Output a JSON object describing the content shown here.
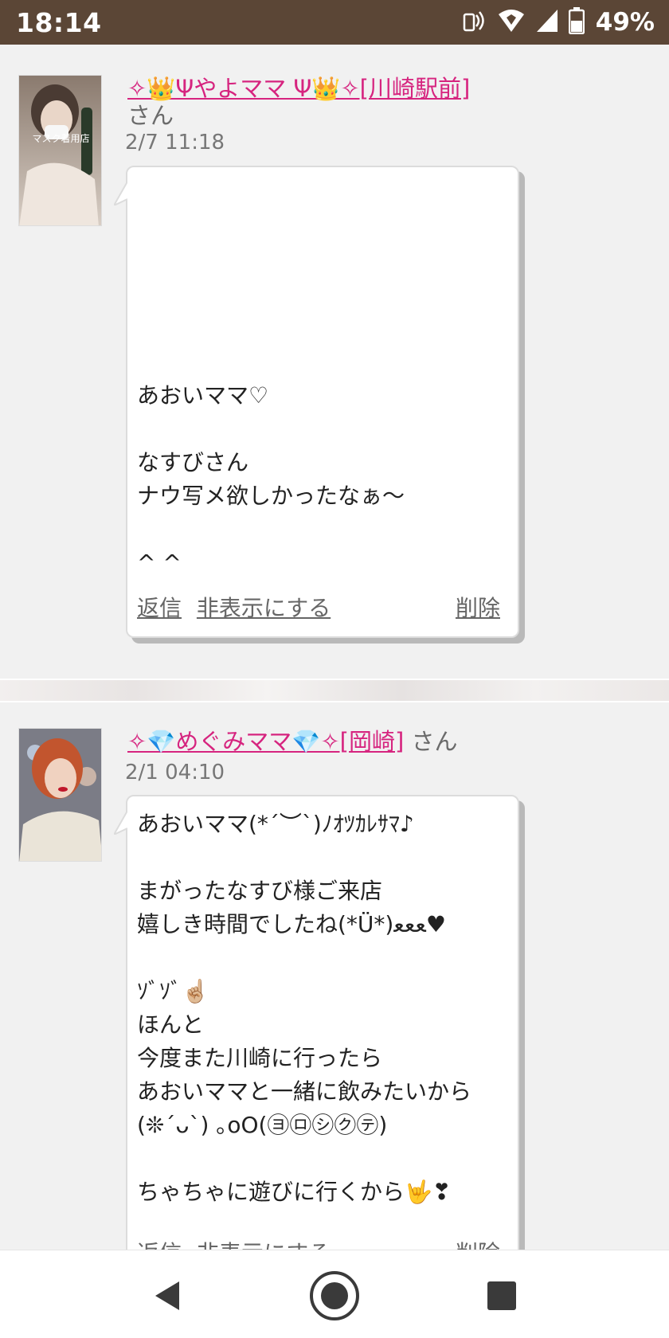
{
  "status": {
    "time": "18:14",
    "battery": "49%",
    "icons": [
      "nfc-icon",
      "wifi-icon",
      "signal-icon",
      "battery-icon"
    ]
  },
  "messages": [
    {
      "name": "✧👑Ψやよママ Ψ👑✧[川崎駅前]",
      "suffix": "さん",
      "date": "2/7 11:18",
      "avatar_caption": "マスク着用店",
      "body": "\n\n\n\n\n\nあおいママ♡\n\nなすびさん\nナウ写メ欲しかったなぁ〜\n\n^ ^\n\n",
      "reply": "返信",
      "hide": "非表示にする",
      "delete": "削除"
    },
    {
      "name": "✧💎めぐみママ💎✧[岡崎]",
      "suffix": "さん",
      "date": "2/1 04:10",
      "body": "あおいママ(*´︶`)ﾉｵﾂｶﾚｻﾏ♪\n\nまがったなすび様ご来店\n嬉しき時間でしたね(*Ü*)ﻌﻌﻌ♥\n\nｿﾞｿﾞ☝🏼\nほんと\n今度また川崎に行ったら\nあおいママと一緒に飲みたいから\n(❊´ᴗ`) ｡oO(㋵㋺㋛㋗㋢)\n\nちゃちゃに遊びに行くから🤟❣",
      "reply": "返信",
      "hide": "非表示にする",
      "delete": "削除"
    }
  ],
  "nav": [
    "back-icon",
    "home-icon",
    "recents-icon"
  ],
  "colors": {
    "statusbar": "#5b4636",
    "name_link": "#d6247f",
    "background": "#f1f1f1"
  }
}
